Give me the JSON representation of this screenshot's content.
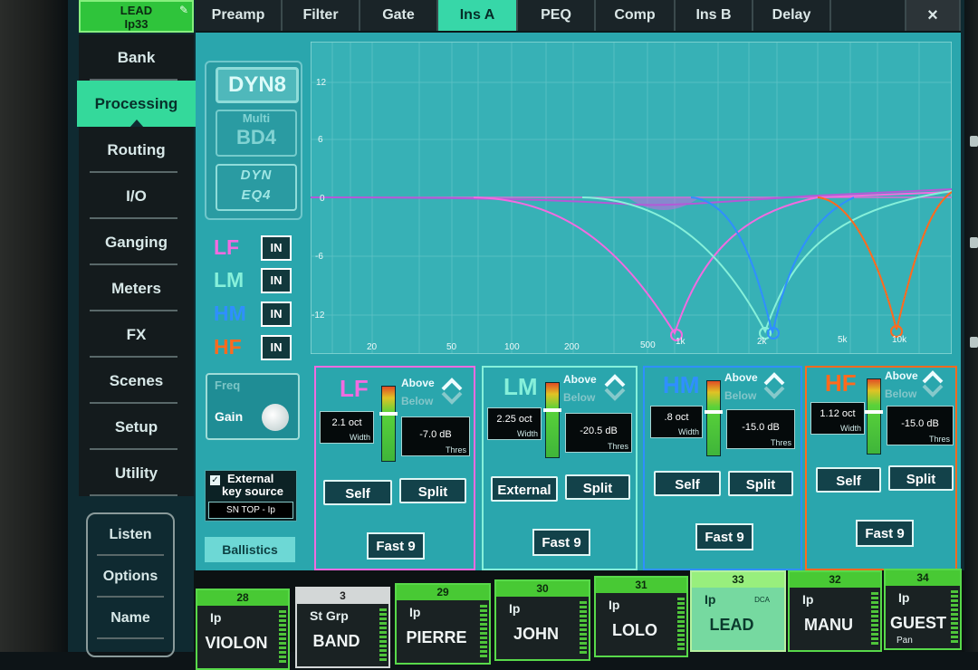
{
  "channel": {
    "line1": "LEAD",
    "line2": "Ip33"
  },
  "tabs": [
    {
      "label": "Preamp"
    },
    {
      "label": "Filter"
    },
    {
      "label": "Gate"
    },
    {
      "label": "Ins A"
    },
    {
      "label": "PEQ"
    },
    {
      "label": "Comp"
    },
    {
      "label": "Ins B"
    },
    {
      "label": "Delay"
    },
    {
      "label": "×"
    }
  ],
  "nav": {
    "items": [
      {
        "label": "Bank"
      },
      {
        "label": "Processing"
      },
      {
        "label": "Routing"
      },
      {
        "label": "I/O"
      },
      {
        "label": "Ganging"
      },
      {
        "label": "Meters"
      },
      {
        "label": "FX"
      },
      {
        "label": "Scenes"
      },
      {
        "label": "Setup"
      },
      {
        "label": "Utility"
      }
    ],
    "box_items": [
      {
        "label": "Listen"
      },
      {
        "label": "Options"
      },
      {
        "label": "Name"
      }
    ]
  },
  "dyn": {
    "dyn8": "DYN8",
    "multi": "Multi",
    "bd4": "BD4",
    "dyn_top": "DYN",
    "eq4": "EQ4"
  },
  "bands_in": [
    {
      "label": "LF",
      "in": "IN",
      "color": "#f26be0"
    },
    {
      "label": "LM",
      "in": "IN",
      "color": "#86f0da"
    },
    {
      "label": "HM",
      "in": "IN",
      "color": "#2f8fff"
    },
    {
      "label": "HF",
      "in": "IN",
      "color": "#ff6a1e"
    }
  ],
  "freq_gain": {
    "freq": "Freq",
    "gain": "Gain"
  },
  "external_key": {
    "label_line1": "External",
    "label_line2": "key source",
    "source": "SN TOP - Ip"
  },
  "ballistics": "Ballistics",
  "graph": {
    "y_ticks": [
      "12",
      "6",
      "0",
      "-6",
      "-12"
    ],
    "x_ticks": [
      "20",
      "50",
      "100",
      "200",
      "500",
      "1k",
      "2k",
      "5k",
      "10k"
    ]
  },
  "bands": [
    {
      "name": "LF",
      "color": "#f26be0",
      "width": "2.1 oct",
      "width_label": "Width",
      "threshold": "-7.0 dB",
      "thres_label": "Thres",
      "above": "Above",
      "below": "Below",
      "btn_left": "Self",
      "btn_right": "Split",
      "fast": "Fast 9"
    },
    {
      "name": "LM",
      "color": "#86f0da",
      "width": "2.25 oct",
      "width_label": "Width",
      "threshold": "-20.5 dB",
      "thres_label": "Thres",
      "above": "Above",
      "below": "Below",
      "btn_left": "External",
      "btn_right": "Split",
      "fast": "Fast 9"
    },
    {
      "name": "HM",
      "color": "#2f8fff",
      "width": ".8 oct",
      "width_label": "Width",
      "threshold": "-15.0 dB",
      "thres_label": "Thres",
      "above": "Above",
      "below": "Below",
      "btn_left": "Self",
      "btn_right": "Split",
      "fast": "Fast 9"
    },
    {
      "name": "HF",
      "color": "#ff6a1e",
      "width": "1.12 oct",
      "width_label": "Width",
      "threshold": "-15.0 dB",
      "thres_label": "Thres",
      "above": "Above",
      "below": "Below",
      "btn_left": "Self",
      "btn_right": "Split",
      "fast": "Fast 9"
    }
  ],
  "strips": [
    {
      "num": "28",
      "src": "Ip",
      "name": "VIOLON"
    },
    {
      "num": "3",
      "src": "St Grp",
      "name": "BAND"
    },
    {
      "num": "29",
      "src": "Ip",
      "name": "PIERRE"
    },
    {
      "num": "30",
      "src": "Ip",
      "name": "JOHN"
    },
    {
      "num": "31",
      "src": "Ip",
      "name": "LOLO"
    },
    {
      "num": "33",
      "src": "Ip",
      "name": "LEAD",
      "tag": "DCA"
    },
    {
      "num": "32",
      "src": "Ip",
      "name": "MANU"
    },
    {
      "num": "34",
      "src": "Ip",
      "name": "GUEST",
      "sub": "Pan"
    }
  ]
}
